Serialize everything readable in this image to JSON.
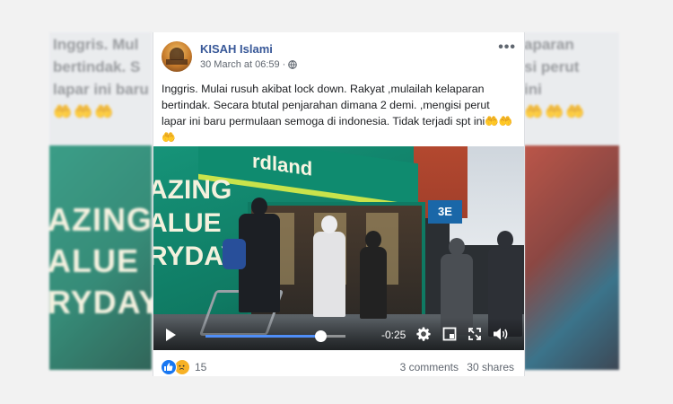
{
  "background": {
    "left_text": [
      "Inggris. Mul",
      "bertindak. S",
      "lapar ini baru"
    ],
    "right_text": [
      "aparan",
      "si perut",
      "ini"
    ],
    "left_poster": [
      "AZING",
      "ALUE",
      "RYDAY"
    ]
  },
  "post": {
    "author": "KISAH Islami",
    "timestamp": "30 March at 06:59",
    "separator": "·",
    "more_label": "•••",
    "text": "Inggris. Mulai rusuh akibat lock down. Rakyat ,mulailah kelaparan bertindak. Secara btutal penjarahan dimana 2 demi. ,mengisi perut lapar ini baru permulaan semoga di indonesia. Tidak terjadi spt ini",
    "emoji": "🤲🤲🤲"
  },
  "video": {
    "store_sign": "rdland",
    "poster_lines": [
      "AZING",
      "ALUE",
      "RYDAY"
    ],
    "side_sign": "3E",
    "time_remaining": "-0:25",
    "progress": 0.82
  },
  "footer": {
    "reaction_count": "15",
    "comments": "3 comments",
    "shares": "30 shares"
  },
  "colors": {
    "link": "#385898",
    "like": "#1877f2",
    "sad": "#f7b125",
    "progress": "#4f8ef7"
  }
}
